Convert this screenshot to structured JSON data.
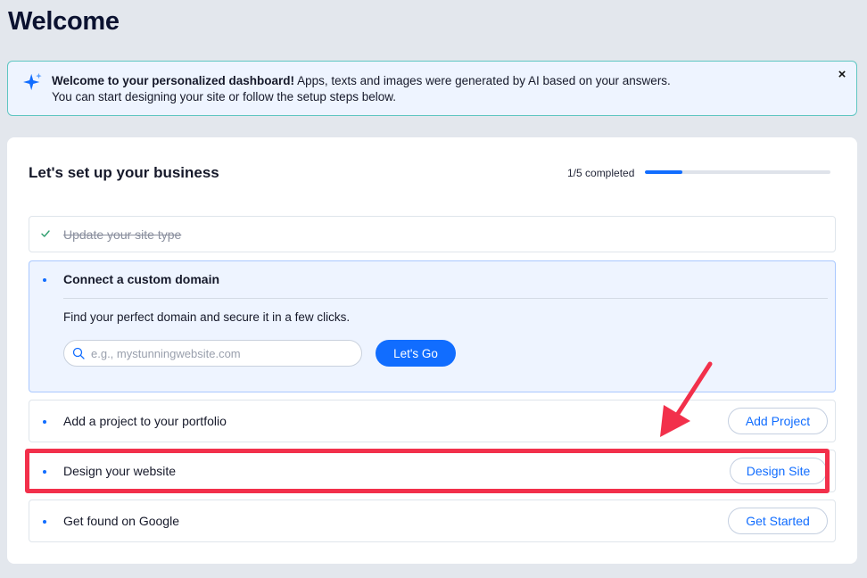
{
  "page": {
    "title": "Welcome"
  },
  "banner": {
    "bold_text": "Welcome to your personalized dashboard!",
    "body_text": " Apps, texts and images were generated by AI based on your answers. You can start designing your site or follow the setup steps below.",
    "close_symbol": "×",
    "accent_color": "#116dff"
  },
  "setup": {
    "title": "Let's set up your business",
    "progress_text": "1/5 completed",
    "progress_fraction": 0.2,
    "steps": [
      {
        "label": "Update your site type",
        "status": "completed"
      },
      {
        "label": "Connect a custom domain",
        "status": "expanded",
        "description": "Find your perfect domain and secure it in a few clicks.",
        "input_placeholder": "e.g., mystunningwebsite.com",
        "input_value": "",
        "button_label": "Let's Go"
      },
      {
        "label": "Add a project to your portfolio",
        "button_label": "Add Project"
      },
      {
        "label": "Design your website",
        "button_label": "Design Site",
        "highlighted": true
      },
      {
        "label": "Get found on Google",
        "button_label": "Get Started"
      }
    ]
  },
  "icons": {
    "banner": "sparkle-icon",
    "completed_step": "check-icon",
    "domain_input": "search-icon",
    "annotation": "red-arrow-icon"
  },
  "colors": {
    "primary": "#116dff",
    "highlight": "#f2304b",
    "banner_border": "#5fc6c2",
    "check": "#2e9e6e"
  }
}
